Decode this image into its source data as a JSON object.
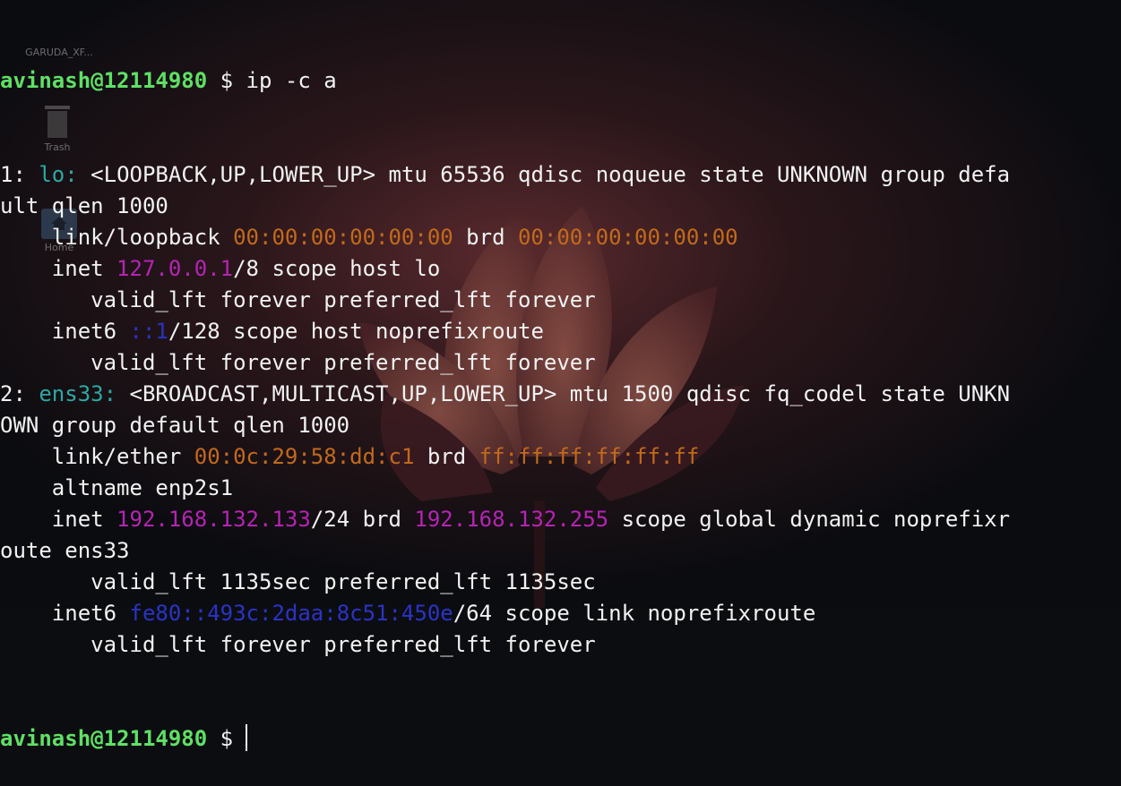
{
  "desktop": {
    "icons": [
      {
        "label": "GARUDA_XF...",
        "icon": "drive-icon"
      },
      {
        "label": "Trash",
        "icon": "trash-icon"
      },
      {
        "label": "Home",
        "icon": "home-folder-icon"
      }
    ]
  },
  "prompt": {
    "user": "avinash@12114980",
    "symbol": " $ ",
    "command": "ip -c a"
  },
  "lines": [
    [
      {
        "t": "1: "
      },
      {
        "t": "lo:",
        "c": "iface"
      },
      {
        "t": " <LOOPBACK,UP,LOWER_UP> mtu 65536 qdisc noqueue state UNKNOWN group defa"
      }
    ],
    [
      {
        "t": "ult qlen 1000"
      }
    ],
    [
      {
        "t": "    link/loopback "
      },
      {
        "t": "00:00:00:00:00:00",
        "c": "mac"
      },
      {
        "t": " brd "
      },
      {
        "t": "00:00:00:00:00:00",
        "c": "mac"
      }
    ],
    [
      {
        "t": "    inet "
      },
      {
        "t": "127.0.0.1",
        "c": "ip4"
      },
      {
        "t": "/8 scope host lo"
      }
    ],
    [
      {
        "t": "       valid_lft forever preferred_lft forever"
      }
    ],
    [
      {
        "t": "    inet6 "
      },
      {
        "t": "::1",
        "c": "ip6"
      },
      {
        "t": "/128 scope host noprefixroute"
      }
    ],
    [
      {
        "t": "       valid_lft forever preferred_lft forever"
      }
    ],
    [
      {
        "t": "2: "
      },
      {
        "t": "ens33:",
        "c": "iface"
      },
      {
        "t": " <BROADCAST,MULTICAST,UP,LOWER_UP> mtu 1500 qdisc fq_codel state UNKN"
      }
    ],
    [
      {
        "t": "OWN group default qlen 1000"
      }
    ],
    [
      {
        "t": "    link/ether "
      },
      {
        "t": "00:0c:29:58:dd:c1",
        "c": "mac"
      },
      {
        "t": " brd "
      },
      {
        "t": "ff:ff:ff:ff:ff:ff",
        "c": "mac"
      }
    ],
    [
      {
        "t": "    altname enp2s1"
      }
    ],
    [
      {
        "t": "    inet "
      },
      {
        "t": "192.168.132.133",
        "c": "ip4"
      },
      {
        "t": "/24 brd "
      },
      {
        "t": "192.168.132.255",
        "c": "ip4"
      },
      {
        "t": " scope global dynamic noprefixr"
      }
    ],
    [
      {
        "t": "oute ens33"
      }
    ],
    [
      {
        "t": "       valid_lft 1135sec preferred_lft 1135sec"
      }
    ],
    [
      {
        "t": "    inet6 "
      },
      {
        "t": "fe80::493c:2daa:8c51:450e",
        "c": "ip6"
      },
      {
        "t": "/64 scope link noprefixroute"
      }
    ],
    [
      {
        "t": "       valid_lft forever preferred_lft forever"
      }
    ]
  ],
  "final_prompt": {
    "user": "avinash@12114980",
    "symbol": " $"
  },
  "colors": {
    "user": "#5fe065",
    "interface": "#2ea8a4",
    "mac": "#c26a1c",
    "ipv4": "#b524b3",
    "ipv6": "#2a34c4",
    "text": "#f2f2f2"
  }
}
